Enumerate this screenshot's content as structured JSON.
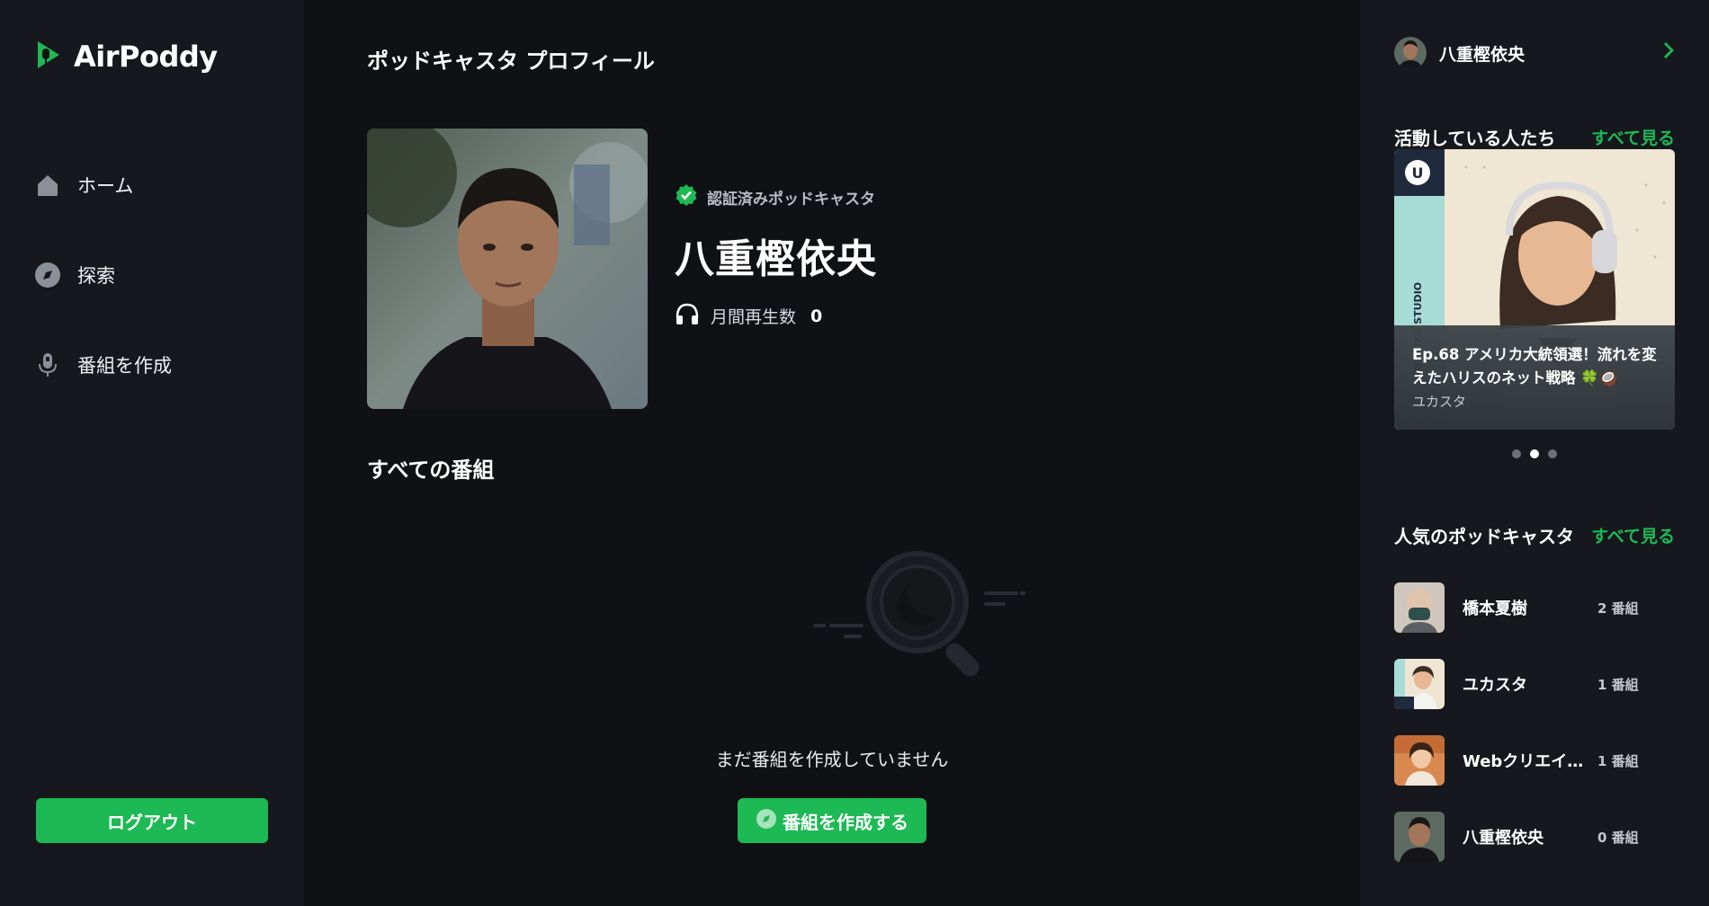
{
  "brand": {
    "name": "AirPoddy"
  },
  "sidebar": {
    "items": [
      {
        "label": "ホーム",
        "icon": "home-icon"
      },
      {
        "label": "探索",
        "icon": "compass-icon"
      },
      {
        "label": "番組を作成",
        "icon": "microphone-icon"
      }
    ],
    "logout_label": "ログアウト"
  },
  "main": {
    "page_title": "ポッドキャスタ プロフィール",
    "verified_label": "認証済みポッドキャスタ",
    "profile_name": "八重樫依央",
    "plays_label": "月間再生数",
    "plays_count": "0",
    "section_title": "すべての番組",
    "empty_text": "まだ番組を作成していません",
    "create_button_label": "番組を作成する"
  },
  "right_panel": {
    "user_name": "八重樫依央",
    "active_heading": "活動している人たち",
    "see_all": "すべて見る",
    "featured": {
      "title": "Ep.68 アメリカ大統領選！流れを変えたハリスのネット戦略 🍀🥥",
      "author": "ユカスタ",
      "brand_vertical": "BY YUKA STUDIO"
    },
    "carousel_active_index": 1,
    "popular_heading": "人気のポッドキャスタ",
    "popular": [
      {
        "name": "橋本夏樹",
        "count": "2 番組"
      },
      {
        "name": "ユカスタ",
        "count": "1 番組"
      },
      {
        "name": "Webクリエイ…",
        "count": "1 番組"
      },
      {
        "name": "八重樫依央",
        "count": "0 番組"
      }
    ]
  },
  "colors": {
    "accent": "#1db954",
    "bg": "#0f1115",
    "panel": "#16181d"
  }
}
